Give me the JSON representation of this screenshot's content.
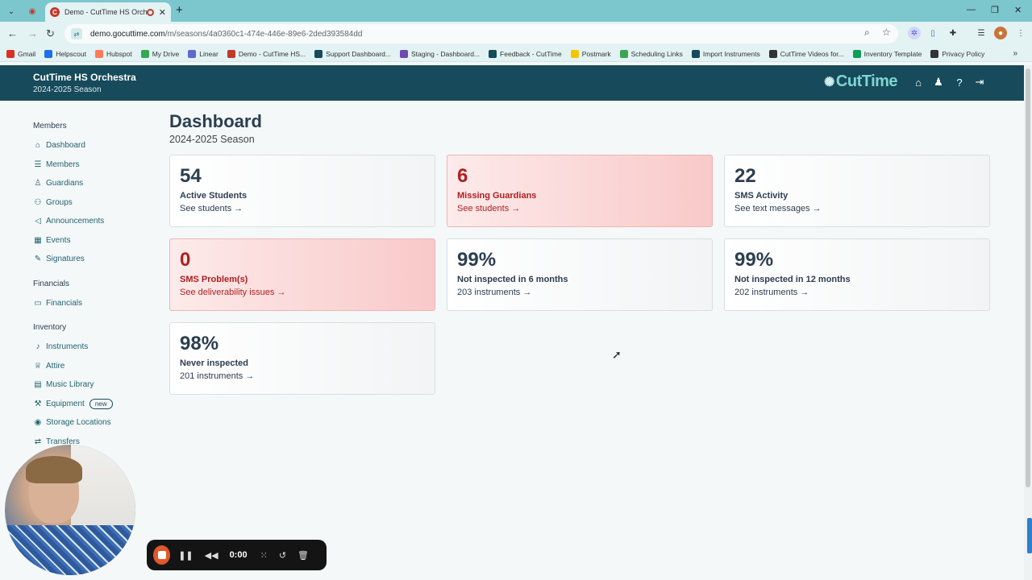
{
  "browser": {
    "tab_title": "Demo - CutTime HS Orchest",
    "url_host": "demo.gocuttime.com",
    "url_path": "/m/seasons/4a0360c1-474e-446e-89e6-2ded393584dd",
    "bookmarks": [
      {
        "label": "Gmail",
        "icon": "gmail-icon",
        "color": "#d93025"
      },
      {
        "label": "Helpscout",
        "icon": "helpscout-icon",
        "color": "#1f6feb"
      },
      {
        "label": "Hubspot",
        "icon": "hubspot-icon",
        "color": "#ff7a59"
      },
      {
        "label": "My Drive",
        "icon": "drive-icon",
        "color": "#34a853"
      },
      {
        "label": "Linear",
        "icon": "linear-icon",
        "color": "#5e6ad2"
      },
      {
        "label": "Demo - CutTime HS...",
        "icon": "cuttime-icon",
        "color": "#c0392b"
      },
      {
        "label": "Support Dashboard...",
        "icon": "cuttime-icon",
        "color": "#174a5a"
      },
      {
        "label": "Staging - Dashboard...",
        "icon": "cuttime-icon",
        "color": "#6d4bb3"
      },
      {
        "label": "Feedback - CutTime",
        "icon": "cuttime-icon",
        "color": "#174a5a"
      },
      {
        "label": "Postmark",
        "icon": "postmark-icon",
        "color": "#f5c400"
      },
      {
        "label": "Scheduling Links",
        "icon": "calendar-icon",
        "color": "#3aa655"
      },
      {
        "label": "Import Instruments",
        "icon": "cuttime-icon",
        "color": "#174a5a"
      },
      {
        "label": "CutTime Videos for...",
        "icon": "video-icon",
        "color": "#333333"
      },
      {
        "label": "Inventory Template",
        "icon": "sheets-icon",
        "color": "#0f9d58"
      },
      {
        "label": "Privacy Policy",
        "icon": "policy-icon",
        "color": "#333333"
      }
    ]
  },
  "header": {
    "org_name": "CutTime HS Orchestra",
    "season": "2024-2025 Season",
    "brand": "CutTime"
  },
  "sidebar": {
    "sections": [
      {
        "title": "Members",
        "items": [
          {
            "label": "Dashboard",
            "icon": "home-icon",
            "glyph": "⌂"
          },
          {
            "label": "Members",
            "icon": "users-icon",
            "glyph": "☰"
          },
          {
            "label": "Guardians",
            "icon": "guardian-icon",
            "glyph": "♙"
          },
          {
            "label": "Groups",
            "icon": "groups-icon",
            "glyph": "⚇"
          },
          {
            "label": "Announcements",
            "icon": "megaphone-icon",
            "glyph": "◁"
          },
          {
            "label": "Events",
            "icon": "calendar-icon",
            "glyph": "▦"
          },
          {
            "label": "Signatures",
            "icon": "signature-icon",
            "glyph": "✎"
          }
        ]
      },
      {
        "title": "Financials",
        "items": [
          {
            "label": "Financials",
            "icon": "money-icon",
            "glyph": "▭"
          }
        ]
      },
      {
        "title": "Inventory",
        "items": [
          {
            "label": "Instruments",
            "icon": "instrument-icon",
            "glyph": "♪"
          },
          {
            "label": "Attire",
            "icon": "attire-icon",
            "glyph": "♕"
          },
          {
            "label": "Music Library",
            "icon": "book-icon",
            "glyph": "▤"
          },
          {
            "label": "Equipment",
            "icon": "equipment-icon",
            "glyph": "⚒",
            "badge": "new"
          },
          {
            "label": "Storage Locations",
            "icon": "location-icon",
            "glyph": "◉"
          },
          {
            "label": "Transfers",
            "icon": "transfer-icon",
            "glyph": "⇄"
          }
        ]
      }
    ]
  },
  "main": {
    "title": "Dashboard",
    "subtitle": "2024-2025 Season",
    "cards": [
      {
        "value": "54",
        "label": "Active Students",
        "link": "See students →",
        "alert": false
      },
      {
        "value": "6",
        "label": "Missing Guardians",
        "link": "See students →",
        "alert": true
      },
      {
        "value": "22",
        "label": "SMS Activity",
        "link": "See text messages →",
        "alert": false
      },
      {
        "value": "0",
        "label": "SMS Problem(s)",
        "link": "See deliverability issues →",
        "alert": true
      },
      {
        "value": "99%",
        "label": "Not inspected in 6 months",
        "link": "203 instruments →",
        "alert": false
      },
      {
        "value": "99%",
        "label": "Not inspected in 12 months",
        "link": "202 instruments →",
        "alert": false
      },
      {
        "value": "98%",
        "label": "Never inspected",
        "link": "201 instruments →",
        "alert": false
      }
    ]
  },
  "recorder": {
    "time": "0:00"
  }
}
